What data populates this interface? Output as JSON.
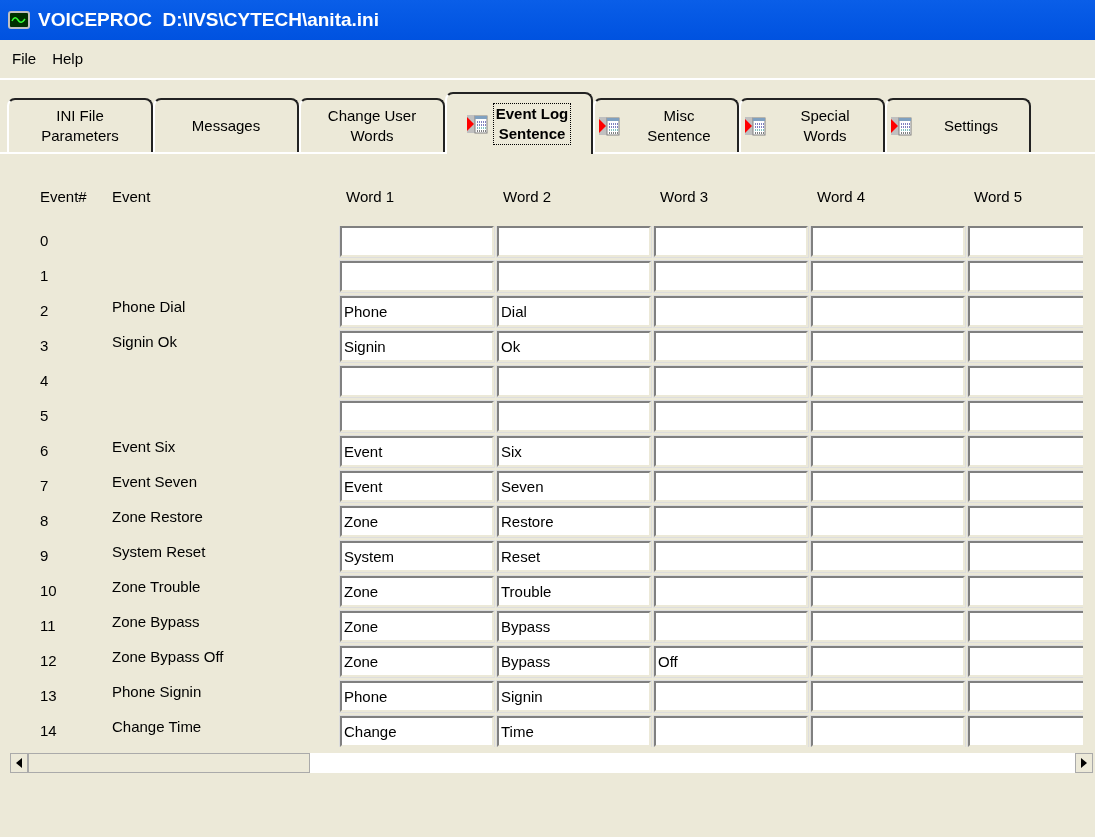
{
  "window": {
    "title": "VOICEPROC  D:\\IVS\\CYTECH\\anita.ini"
  },
  "menu": [
    "File",
    "Help"
  ],
  "tabs": [
    {
      "label": [
        "INI File",
        "Parameters"
      ],
      "icon": false,
      "selected": false
    },
    {
      "label": [
        "Messages"
      ],
      "icon": false,
      "selected": false
    },
    {
      "label": [
        "Change User",
        "Words"
      ],
      "icon": false,
      "selected": false
    },
    {
      "label": [
        "Event Log",
        "Sentence"
      ],
      "icon": true,
      "selected": true
    },
    {
      "label": [
        "Misc",
        "Sentence"
      ],
      "icon": true,
      "selected": false
    },
    {
      "label": [
        "Special",
        "Words"
      ],
      "icon": true,
      "selected": false
    },
    {
      "label": [
        "Settings"
      ],
      "icon": true,
      "selected": false
    }
  ],
  "table": {
    "columns": [
      "Event#",
      "Event",
      "Word 1",
      "Word 2",
      "Word 3",
      "Word 4",
      "Word 5"
    ],
    "rows": [
      {
        "number": "0",
        "event": "",
        "words": []
      },
      {
        "number": "1",
        "event": "",
        "words": []
      },
      {
        "number": "2",
        "event": "Phone Dial",
        "words": [
          "Phone",
          "Dial"
        ]
      },
      {
        "number": "3",
        "event": "Signin Ok",
        "words": [
          "Signin",
          "Ok"
        ]
      },
      {
        "number": "4",
        "event": "",
        "words": []
      },
      {
        "number": "5",
        "event": "",
        "words": []
      },
      {
        "number": "6",
        "event": "Event Six",
        "words": [
          "Event",
          "Six"
        ]
      },
      {
        "number": "7",
        "event": "Event Seven",
        "words": [
          "Event",
          "Seven"
        ]
      },
      {
        "number": "8",
        "event": "Zone Restore",
        "words": [
          "Zone",
          "Restore"
        ]
      },
      {
        "number": "9",
        "event": "System Reset",
        "words": [
          "System",
          "Reset"
        ]
      },
      {
        "number": "10",
        "event": "Zone Trouble",
        "words": [
          "Zone",
          "Trouble"
        ]
      },
      {
        "number": "11",
        "event": "Zone Bypass",
        "words": [
          "Zone",
          "Bypass"
        ]
      },
      {
        "number": "12",
        "event": "Zone Bypass Off",
        "words": [
          "Zone",
          "Bypass",
          "Off"
        ]
      },
      {
        "number": "13",
        "event": "Phone Signin",
        "words": [
          "Phone",
          "Signin"
        ]
      },
      {
        "number": "14",
        "event": "Change Time",
        "words": [
          "Change",
          "Time"
        ]
      }
    ]
  }
}
